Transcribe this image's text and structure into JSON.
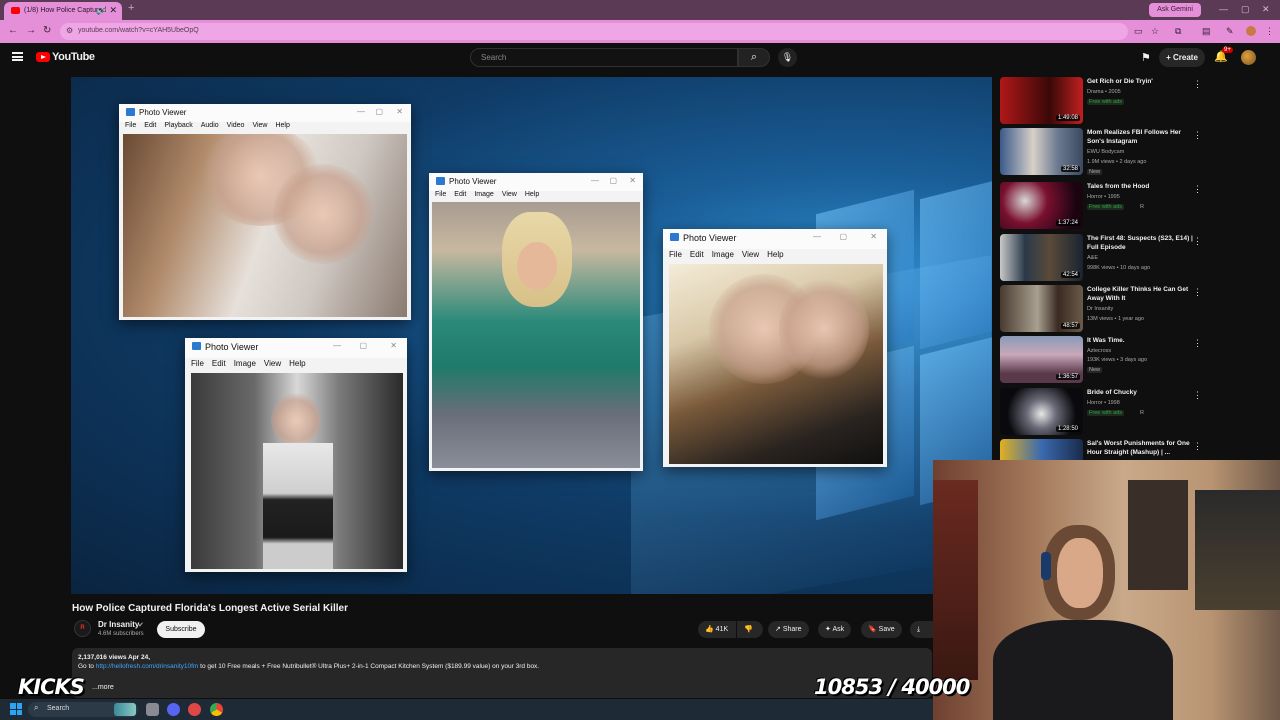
{
  "browser": {
    "tab_title": "(1/8) How Police Captured",
    "new_tab": "+",
    "ask_gemini": "Ask Gemini",
    "url": "youtube.com/watch?v=cYAH5UbeOpQ"
  },
  "header": {
    "logo_text": "YouTube",
    "search_placeholder": "Search",
    "create_label": "Create",
    "notif_count": "9+"
  },
  "player": {
    "photo_windows": [
      {
        "title": "Photo Viewer",
        "menu": [
          "File",
          "Edit",
          "Playback",
          "Audio",
          "Video",
          "View",
          "Help"
        ]
      },
      {
        "title": "Photo Viewer",
        "menu": [
          "File",
          "Edit",
          "Image",
          "View",
          "Help"
        ]
      },
      {
        "title": "Photo Viewer",
        "menu": [
          "File",
          "Edit",
          "Image",
          "View",
          "Help"
        ]
      },
      {
        "title": "Photo Viewer",
        "menu": [
          "File",
          "Edit",
          "Image",
          "View",
          "Help"
        ]
      }
    ]
  },
  "video": {
    "title": "How Police Captured Florida's Longest Active Serial Killer",
    "channel_name": "Dr Insanity",
    "channel_avatar_text": "R",
    "subscribers": "4.6M subscribers",
    "subscribe_label": "Subscribe",
    "likes": "41K",
    "share_label": "Share",
    "ask_label": "Ask",
    "save_label": "Save",
    "stats": "2,137,016 views  Apr 24,",
    "desc_prefix": "Go to ",
    "desc_link": "http://hellofresh.com/drinsanity10fm",
    "desc_suffix": " to get 10 Free meals + Free Nutribullet® Ultra Plus+ 2-in-1 Compact Kitchen System ($189.99 value) on your 3rd box.",
    "more_label": "...more"
  },
  "sidebar": {
    "items": [
      {
        "title": "Get Rich or Die Tryin'",
        "meta1": "Drama • 2005",
        "badge": "Free with ads",
        "duration": "1:49:08",
        "thumb_color": "#8c1a1a"
      },
      {
        "title": "Mom Realizes FBI Follows Her Son's Instagram",
        "meta1": "EWU Bodycam",
        "meta2": "1.9M views • 2 days ago",
        "new_label": "New",
        "duration": "32:58",
        "thumb_color": "#4d5a70"
      },
      {
        "title": "Tales from the Hood",
        "meta1": "Horror • 1995",
        "badge": "Free with ads",
        "badge_extra": "R",
        "duration": "1:37:24",
        "thumb_color": "#5a1228"
      },
      {
        "title": "The First 48: Suspects (S23, E14) | Full Episode",
        "meta1": "A&E",
        "meta2": "998K views • 10 days ago",
        "duration": "42:54",
        "thumb_color": "#24303c"
      },
      {
        "title": "College Killer Thinks He Can Get Away With It",
        "meta1": "Dr Insanity",
        "meta2": "13M views • 1 year ago",
        "duration": "48:57",
        "thumb_color": "#3e2a22"
      },
      {
        "title": "It Was Time.",
        "meta1": "Aztecross",
        "meta2": "193K views • 3 days ago",
        "new_label": "New",
        "duration": "1:36:57",
        "thumb_color": "#6a4a60"
      },
      {
        "title": "Bride of Chucky",
        "meta1": "Horror • 1998",
        "badge": "Free with ads",
        "badge_extra": "R",
        "duration": "1:28:50",
        "thumb_color": "#101014"
      },
      {
        "title": "Sal's Worst Punishments for One Hour Straight (Mashup) | ...",
        "duration": "",
        "thumb_color": "#e0b020"
      }
    ]
  },
  "overlay": {
    "kicks_label": "KICKS",
    "counter": "10853 / 40000"
  },
  "taskbar": {
    "search_label": "Search"
  },
  "colors": {
    "brand_red": "#ff0000",
    "browser_pink": "#e48fd8",
    "link_blue": "#3ea6ff"
  }
}
